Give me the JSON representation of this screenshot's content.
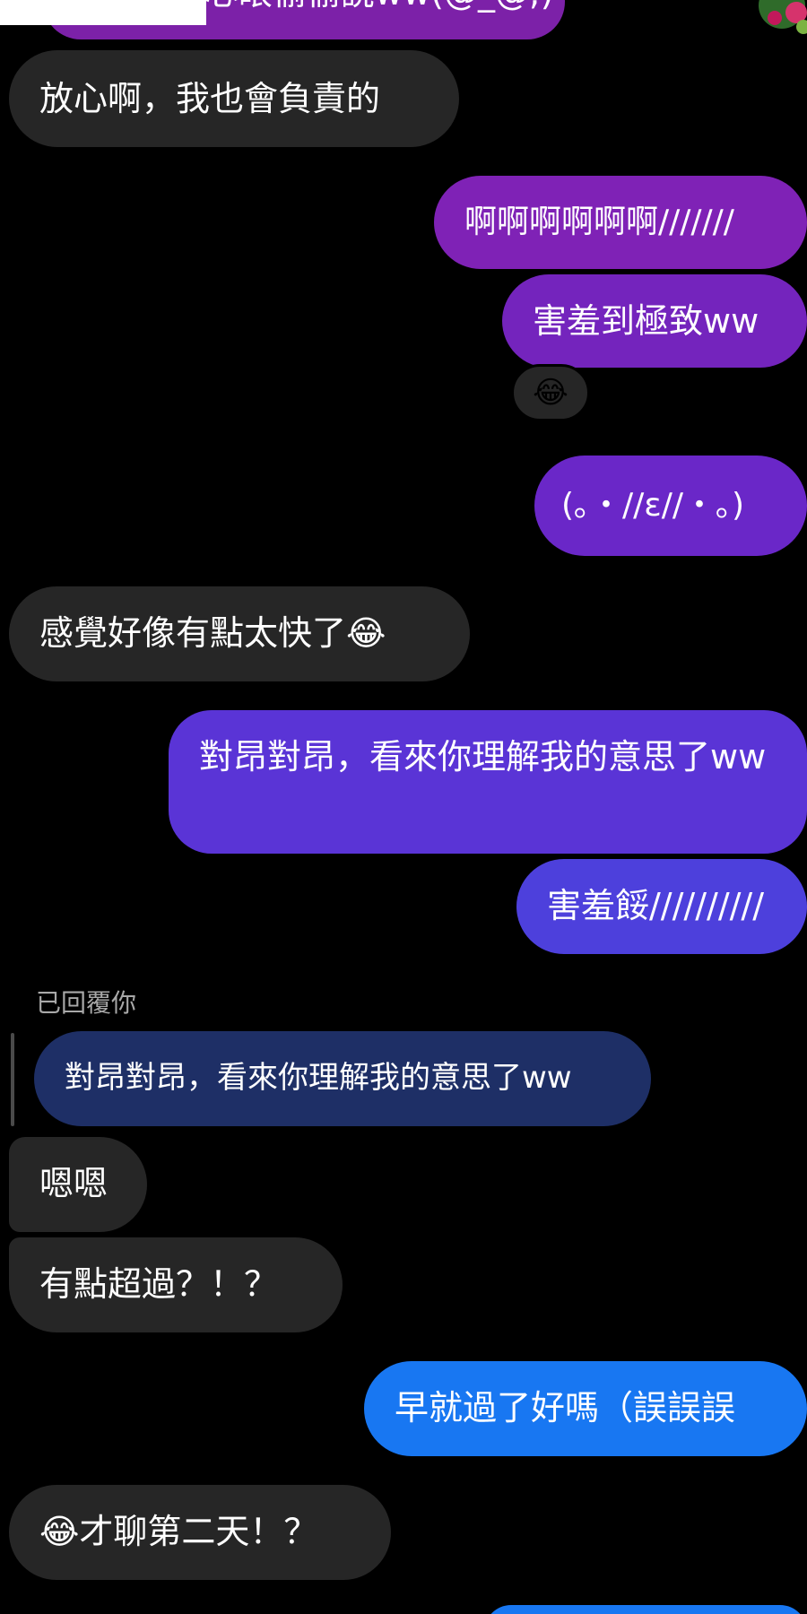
{
  "messages": [
    {
      "side": "sent",
      "text": "心眼偷偷說ww(@_@;)"
    },
    {
      "side": "received",
      "text": "放心啊，我也會負責的"
    },
    {
      "side": "sent",
      "text": "啊啊啊啊啊啊///////"
    },
    {
      "side": "sent",
      "text": "害羞到極致ww",
      "reaction": "😂"
    },
    {
      "side": "sent",
      "text": "(｡・//ε//・｡)"
    },
    {
      "side": "received",
      "text": "感覺好像有點太快了😂"
    },
    {
      "side": "sent",
      "text": "對昂對昂，看來你理解我的意思了ww"
    },
    {
      "side": "sent",
      "text": "害羞餒//////////"
    },
    {
      "side": "received",
      "reply_label": "已回覆你",
      "reply_quote": "對昂對昂，看來你理解我的意思了ww"
    },
    {
      "side": "received",
      "text": "嗯嗯"
    },
    {
      "side": "received",
      "text": "有點超過？！？"
    },
    {
      "side": "sent",
      "text": "早就過了好嗎（誤誤誤"
    },
    {
      "side": "received",
      "text": "😂才聊第二天！？"
    }
  ],
  "colors": {
    "background": "#000000",
    "received_bubble": "#262626",
    "sent_gradient_top": "#8a2ac2",
    "sent_gradient_bottom": "#1877f2",
    "reply_quote": "#1e2f66",
    "meta_text": "#a8a8a8"
  }
}
